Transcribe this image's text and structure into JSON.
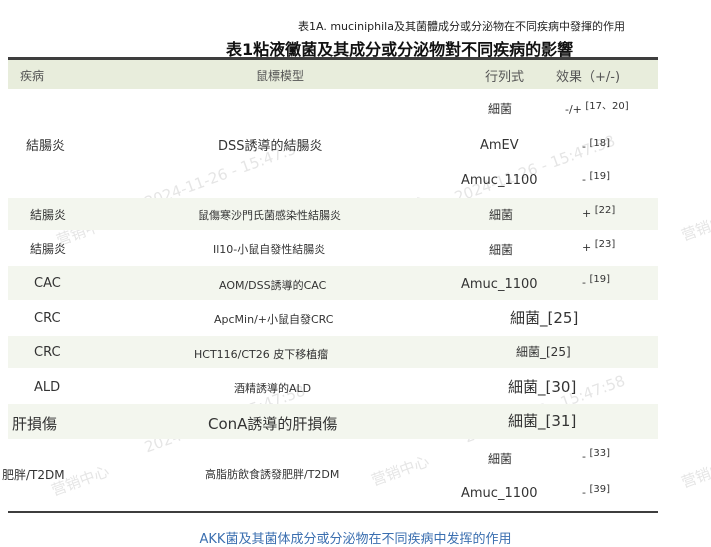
{
  "caption_small": "表1A. muciniphila及其菌體成分或分泌物在不同疾病中發揮的作用",
  "title": "表1粘液黴菌及其成分或分泌物對不同疾病的影響",
  "headers": {
    "disease": "疾病",
    "model": "鼠標模型",
    "form": "行列式",
    "effect": "效果（+/-)"
  },
  "rows": [
    {
      "disease": "結腸炎",
      "model": "DSS誘導的結腸炎",
      "f1": "細菌",
      "e1": "-/+",
      "r1": "[17、20]",
      "f2": "AmEV",
      "e2": "-",
      "r2": "[18]",
      "f3": "Amuc_1100",
      "e3": "-",
      "r3": "[19]"
    },
    {
      "disease": "結腸炎",
      "model": "鼠傷寒沙門氏菌感染性結腸炎",
      "form": "細菌",
      "effect": "+",
      "ref": "[22]"
    },
    {
      "disease": "結腸炎",
      "model": "Il10-小鼠自發性結腸炎",
      "form": "細菌",
      "effect": "+",
      "ref": "[23]"
    },
    {
      "disease": "CAC",
      "model": "AOM/DSS誘導的CAC",
      "form": "Amuc_1100",
      "effect": "-",
      "ref": "[19]"
    },
    {
      "disease": "CRC",
      "model": "ApcMin/+小鼠自發CRC",
      "combined": "細菌_[25]"
    },
    {
      "disease": "CRC",
      "model": "HCT116/CT26 皮下移植瘤",
      "combined": "細菌_[25]"
    },
    {
      "disease": "ALD",
      "model": "酒精誘導的ALD",
      "combined": "細菌_[30]"
    },
    {
      "disease": "肝損傷",
      "model": "ConA誘導的肝損傷",
      "combined": "細菌_[31]"
    },
    {
      "disease": "肥胖/T2DM",
      "model": "高脂肪飲食誘發肥胖/T2DM",
      "f1": "細菌",
      "e1": "-",
      "r1": "[33]",
      "f2": "Amuc_1100",
      "e2": "-",
      "r2": "[39]"
    }
  ],
  "footer_caption": "AKK菌及其菌体成分或分泌物在不同疾病中发挥的作用",
  "watermark_text": "营销中心",
  "watermark_date": "2024-11-26 - 15:47:58",
  "colors": {
    "band": "#f3f6ee",
    "header": "#e8eddc",
    "caption": "#3b6fb0"
  }
}
